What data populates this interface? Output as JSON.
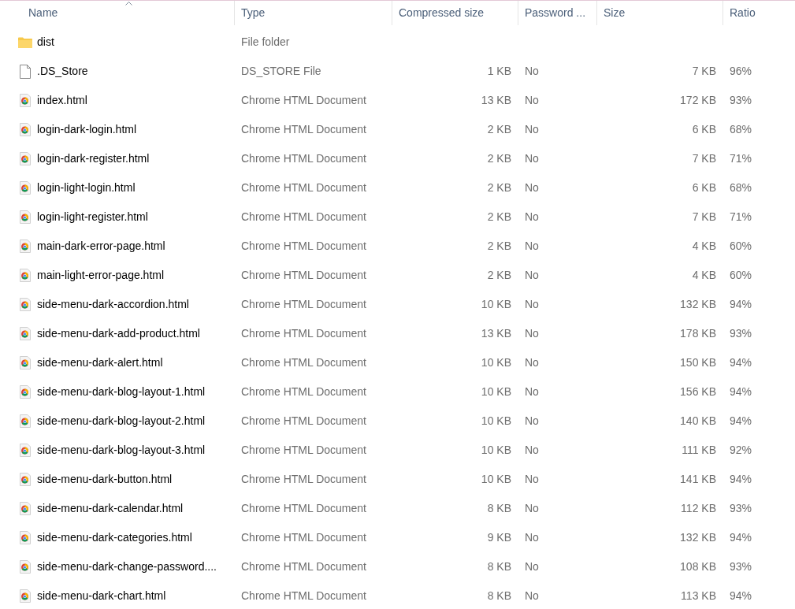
{
  "columns": [
    {
      "label": "Name",
      "sorted": true
    },
    {
      "label": "Type",
      "sorted": false
    },
    {
      "label": "Compressed size",
      "sorted": false
    },
    {
      "label": "Password ...",
      "sorted": false
    },
    {
      "label": "Size",
      "sorted": false
    },
    {
      "label": "Ratio",
      "sorted": false
    }
  ],
  "rows": [
    {
      "kind": "folder",
      "name": "dist",
      "type": "File folder"
    },
    {
      "kind": "file",
      "name": ".DS_Store",
      "type": "DS_STORE File",
      "compressed": "1 KB",
      "password": "No",
      "size": "7 KB",
      "ratio": "96%"
    },
    {
      "kind": "chrome",
      "name": "index.html",
      "type": "Chrome HTML Document",
      "compressed": "13 KB",
      "password": "No",
      "size": "172 KB",
      "ratio": "93%"
    },
    {
      "kind": "chrome",
      "name": "login-dark-login.html",
      "type": "Chrome HTML Document",
      "compressed": "2 KB",
      "password": "No",
      "size": "6 KB",
      "ratio": "68%"
    },
    {
      "kind": "chrome",
      "name": "login-dark-register.html",
      "type": "Chrome HTML Document",
      "compressed": "2 KB",
      "password": "No",
      "size": "7 KB",
      "ratio": "71%"
    },
    {
      "kind": "chrome",
      "name": "login-light-login.html",
      "type": "Chrome HTML Document",
      "compressed": "2 KB",
      "password": "No",
      "size": "6 KB",
      "ratio": "68%"
    },
    {
      "kind": "chrome",
      "name": "login-light-register.html",
      "type": "Chrome HTML Document",
      "compressed": "2 KB",
      "password": "No",
      "size": "7 KB",
      "ratio": "71%"
    },
    {
      "kind": "chrome",
      "name": "main-dark-error-page.html",
      "type": "Chrome HTML Document",
      "compressed": "2 KB",
      "password": "No",
      "size": "4 KB",
      "ratio": "60%"
    },
    {
      "kind": "chrome",
      "name": "main-light-error-page.html",
      "type": "Chrome HTML Document",
      "compressed": "2 KB",
      "password": "No",
      "size": "4 KB",
      "ratio": "60%"
    },
    {
      "kind": "chrome",
      "name": "side-menu-dark-accordion.html",
      "type": "Chrome HTML Document",
      "compressed": "10 KB",
      "password": "No",
      "size": "132 KB",
      "ratio": "94%"
    },
    {
      "kind": "chrome",
      "name": "side-menu-dark-add-product.html",
      "type": "Chrome HTML Document",
      "compressed": "13 KB",
      "password": "No",
      "size": "178 KB",
      "ratio": "93%"
    },
    {
      "kind": "chrome",
      "name": "side-menu-dark-alert.html",
      "type": "Chrome HTML Document",
      "compressed": "10 KB",
      "password": "No",
      "size": "150 KB",
      "ratio": "94%"
    },
    {
      "kind": "chrome",
      "name": "side-menu-dark-blog-layout-1.html",
      "type": "Chrome HTML Document",
      "compressed": "10 KB",
      "password": "No",
      "size": "156 KB",
      "ratio": "94%"
    },
    {
      "kind": "chrome",
      "name": "side-menu-dark-blog-layout-2.html",
      "type": "Chrome HTML Document",
      "compressed": "10 KB",
      "password": "No",
      "size": "140 KB",
      "ratio": "94%"
    },
    {
      "kind": "chrome",
      "name": "side-menu-dark-blog-layout-3.html",
      "type": "Chrome HTML Document",
      "compressed": "10 KB",
      "password": "No",
      "size": "111 KB",
      "ratio": "92%"
    },
    {
      "kind": "chrome",
      "name": "side-menu-dark-button.html",
      "type": "Chrome HTML Document",
      "compressed": "10 KB",
      "password": "No",
      "size": "141 KB",
      "ratio": "94%"
    },
    {
      "kind": "chrome",
      "name": "side-menu-dark-calendar.html",
      "type": "Chrome HTML Document",
      "compressed": "8 KB",
      "password": "No",
      "size": "112 KB",
      "ratio": "93%"
    },
    {
      "kind": "chrome",
      "name": "side-menu-dark-categories.html",
      "type": "Chrome HTML Document",
      "compressed": "9 KB",
      "password": "No",
      "size": "132 KB",
      "ratio": "94%"
    },
    {
      "kind": "chrome",
      "name": "side-menu-dark-change-password....",
      "type": "Chrome HTML Document",
      "compressed": "8 KB",
      "password": "No",
      "size": "108 KB",
      "ratio": "93%"
    },
    {
      "kind": "chrome",
      "name": "side-menu-dark-chart.html",
      "type": "Chrome HTML Document",
      "compressed": "8 KB",
      "password": "No",
      "size": "113 KB",
      "ratio": "94%"
    }
  ]
}
